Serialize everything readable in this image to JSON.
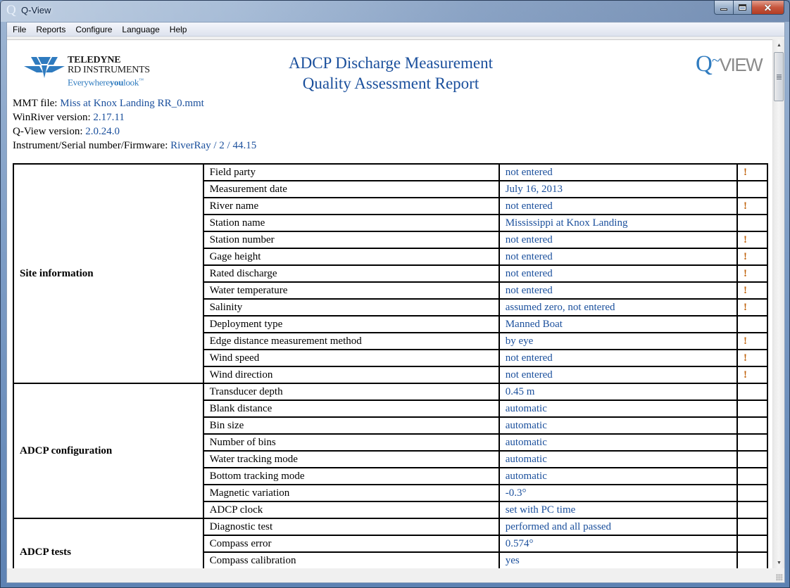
{
  "window": {
    "title": "Q-View",
    "app_icon": "q-view-app-icon"
  },
  "menu": [
    "File",
    "Reports",
    "Configure",
    "Language",
    "Help"
  ],
  "header": {
    "logo": {
      "line1": "TELEDYNE",
      "line2": "RD INSTRUMENTS",
      "tagline_a": "Everywhere",
      "tagline_b": "you",
      "tagline_c": "look",
      "tm": "™"
    },
    "title_line1": "ADCP Discharge Measurement",
    "title_line2": "Quality Assessment Report",
    "qview_logo": {
      "q": "Q",
      "tilde": "~",
      "rest": "VIEW"
    }
  },
  "meta": [
    {
      "label": "MMT file: ",
      "value": "Miss at Knox Landing RR_0.mmt"
    },
    {
      "label": "WinRiver version: ",
      "value": "2.17.11"
    },
    {
      "label": "Q-View version: ",
      "value": "2.0.24.0"
    },
    {
      "label": "Instrument/Serial number/Firmware: ",
      "value": "RiverRay / 2 / 44.15"
    }
  ],
  "sections": [
    {
      "name": "Site information",
      "rows": [
        {
          "label": "Field party",
          "value": "not entered",
          "flag": "!"
        },
        {
          "label": "Measurement date",
          "value": "July 16, 2013",
          "flag": ""
        },
        {
          "label": "River name",
          "value": "not entered",
          "flag": "!"
        },
        {
          "label": "Station name",
          "value": "Mississippi at Knox Landing",
          "flag": ""
        },
        {
          "label": "Station number",
          "value": "not entered",
          "flag": "!"
        },
        {
          "label": "Gage height",
          "value": "not entered",
          "flag": "!"
        },
        {
          "label": "Rated discharge",
          "value": "not entered",
          "flag": "!"
        },
        {
          "label": "Water temperature",
          "value": "not entered",
          "flag": "!"
        },
        {
          "label": "Salinity",
          "value": "assumed zero, not entered",
          "flag": "!"
        },
        {
          "label": "Deployment type",
          "value": "Manned Boat",
          "flag": ""
        },
        {
          "label": "Edge distance measurement method",
          "value": "by eye",
          "flag": "!"
        },
        {
          "label": "Wind speed",
          "value": "not entered",
          "flag": "!"
        },
        {
          "label": "Wind direction",
          "value": "not entered",
          "flag": "!"
        }
      ]
    },
    {
      "name": "ADCP configuration",
      "rows": [
        {
          "label": "Transducer depth",
          "value": "0.45 m",
          "flag": ""
        },
        {
          "label": "Blank distance",
          "value": "automatic",
          "flag": ""
        },
        {
          "label": "Bin size",
          "value": "automatic",
          "flag": ""
        },
        {
          "label": "Number of bins",
          "value": "automatic",
          "flag": ""
        },
        {
          "label": "Water tracking mode",
          "value": "automatic",
          "flag": ""
        },
        {
          "label": "Bottom tracking mode",
          "value": "automatic",
          "flag": ""
        },
        {
          "label": "Magnetic variation",
          "value": "-0.3°",
          "flag": ""
        },
        {
          "label": "ADCP clock",
          "value": "set with PC time",
          "flag": ""
        }
      ]
    },
    {
      "name": "ADCP tests",
      "rows": [
        {
          "label": "Diagnostic test",
          "value": "performed and all passed",
          "flag": ""
        },
        {
          "label": "Compass error",
          "value": "0.574°",
          "flag": ""
        },
        {
          "label": "Compass calibration",
          "value": "yes",
          "flag": ""
        },
        {
          "label": "",
          "value": "",
          "flag": ""
        }
      ]
    }
  ],
  "colors": {
    "value_text": "#1a4f9c",
    "warning_flag": "#c0620b",
    "brand_blue": "#2f7bbf"
  }
}
